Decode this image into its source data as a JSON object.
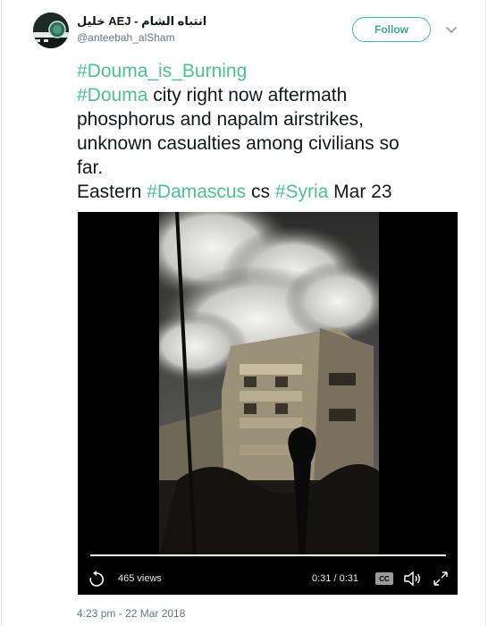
{
  "author": {
    "display_name": "خليل AEJ - انتباه الشام",
    "handle": "@anteebah_alSham"
  },
  "follow_label": "Follow",
  "tweet": {
    "line1_tag": "#Douma_is_Burning",
    "line2_tag": "#Douma",
    "line2_text": " city right now aftermath",
    "line3_text": "phosphorus and napalm airstrikes,",
    "line4_text": "unknown casualties among civilians so",
    "line5_text": "far.",
    "line6_pre": "Eastern ",
    "line6_tag1": "#Damascus",
    "line6_mid": " cs ",
    "line6_tag2": "#Syria",
    "line6_post": " Mar 23"
  },
  "video": {
    "views": "465 views",
    "time": "0:31 / 0:31",
    "cc_label": "CC",
    "progress": 1.0
  },
  "timestamp": "4:23 pm - 22 Mar 2018",
  "colors": {
    "hashtag": "#4fbf94",
    "follow_border": "#4ab5a5",
    "secondary_text": "#657786"
  },
  "icons": [
    "caret-down-icon",
    "replay-icon",
    "cc-icon",
    "volume-icon",
    "fullscreen-icon"
  ]
}
